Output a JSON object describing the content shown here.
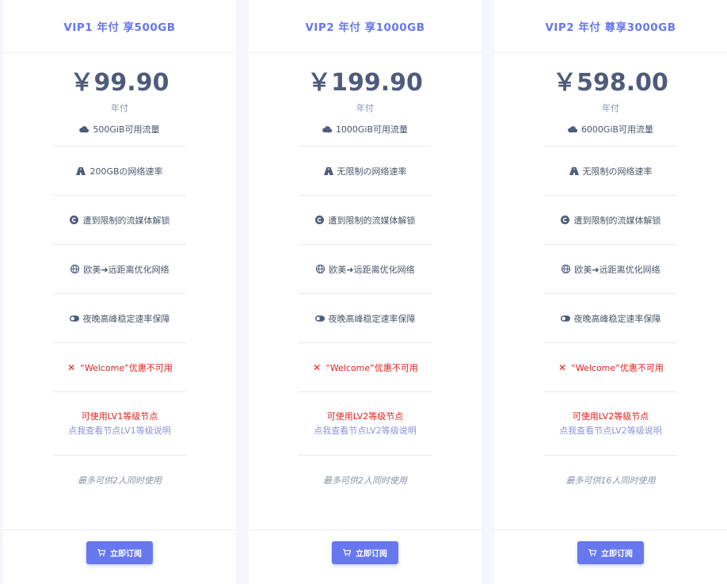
{
  "plans": [
    {
      "title": "VIP1 年付 享500GB",
      "price": "￥99.90",
      "period": "年付",
      "traffic": "500GiB可用流量",
      "speed": "200GBの网络速率",
      "streaming": "遭到限制的流媒体解锁",
      "network": "欧美➜远距离优化网络",
      "peak": "夜晚高峰稳定速率保障",
      "coupon": "“Welcome”优惠不可用",
      "node_level": "可使用LV1等级节点",
      "node_link": "点我查看节点LV1等级说明",
      "device_limit": "最多可供2人同时使用",
      "button": "立即订阅"
    },
    {
      "title": "VIP2 年付 享1000GB",
      "price": "￥199.90",
      "period": "年付",
      "traffic": "1000GiB可用流量",
      "speed": "无限制の网络速率",
      "streaming": "遭到限制的流媒体解锁",
      "network": "欧美➜远距离优化网络",
      "peak": "夜晚高峰稳定速率保障",
      "coupon": "“Welcome”优惠不可用",
      "node_level": "可使用LV2等级节点",
      "node_link": "点我查看节点LV2等级说明",
      "device_limit": "最多可供2人同时使用",
      "button": "立即订阅"
    },
    {
      "title": "VIP2 年付 尊享3000GB",
      "price": "￥598.00",
      "period": "年付",
      "traffic": "6000GiB可用流量",
      "speed": "无限制の网络速率",
      "streaming": "遭到限制的流媒体解锁",
      "network": "欧美➜远距离优化网络",
      "peak": "夜晚高峰稳定速率保障",
      "coupon": "“Welcome”优惠不可用",
      "node_level": "可使用LV2等级节点",
      "node_link": "点我查看节点LV2等级说明",
      "device_limit": "最多可供16人同时使用",
      "button": "立即订阅"
    }
  ],
  "icons": {
    "traffic": "cloud-icon",
    "speed": "road-icon",
    "streaming": "copyright-icon",
    "network": "globe-icon",
    "peak": "toggle-icon",
    "coupon": "close-icon",
    "button": "cart-icon"
  },
  "colors": {
    "accent": "#6777ef",
    "danger": "#e2201c",
    "text": "#4a5568",
    "muted": "#8a93a6"
  }
}
